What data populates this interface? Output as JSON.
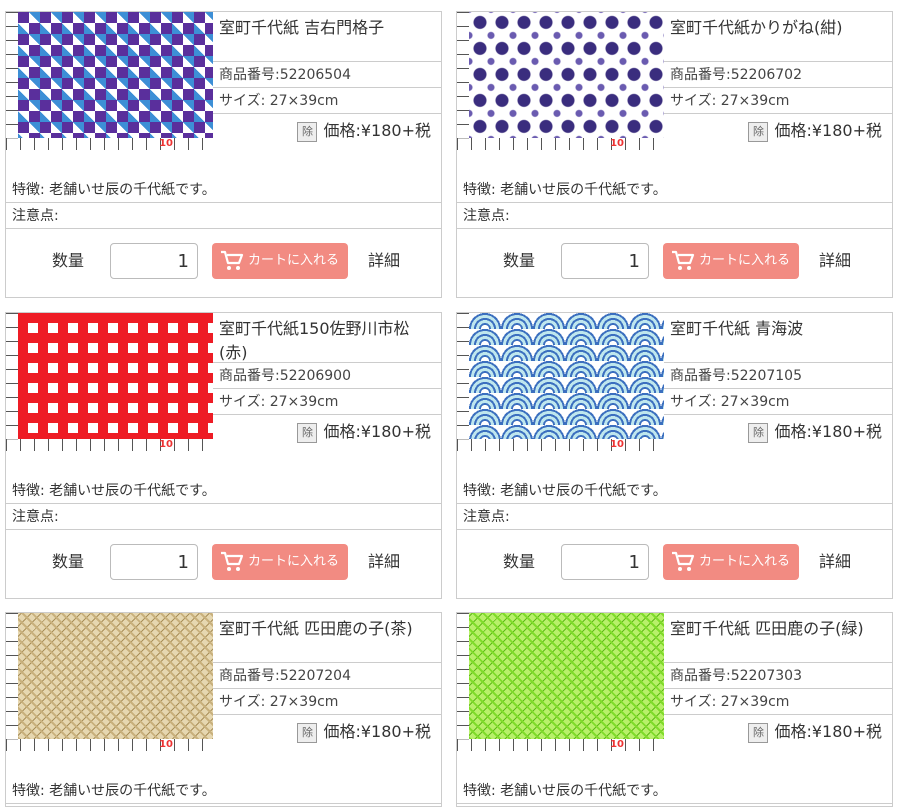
{
  "common": {
    "size": "サイズ: 27×39cm",
    "price": "価格:¥180+税",
    "price_badge": "除",
    "feature": "特徴: 老舗いせ辰の千代紙です。",
    "notice": "注意点:",
    "qty_label": "数量",
    "qty_value": "1",
    "cart_label": "カートに入れる",
    "detail_label": "詳細",
    "ruler_mark": "10"
  },
  "products": [
    {
      "title": "室町千代紙 吉右門格子",
      "code": "商品番号:52206504",
      "colors": [
        "#5a2f9c",
        "#3d8fd6",
        "#ffffff"
      ]
    },
    {
      "title": "室町千代紙かりがね(紺)",
      "code": "商品番号:52206702",
      "colors": [
        "#3a2d7e",
        "#ffffff",
        "#6a5bb0"
      ]
    },
    {
      "title": "室町千代紙150佐野川市松(赤)",
      "code": "商品番号:52206900",
      "colors": [
        "#ee1c25",
        "#ffffff",
        "#ee1c25"
      ]
    },
    {
      "title": "室町千代紙 青海波",
      "code": "商品番号:52207105",
      "colors": [
        "#3b6fbf",
        "#bfe7ee",
        "#ffffff"
      ]
    },
    {
      "title": "室町千代紙 匹田鹿の子(茶)",
      "code": "商品番号:52207204",
      "colors": [
        "#c8b07c",
        "#e6d7b0",
        "#a88e58"
      ]
    },
    {
      "title": "室町千代紙 匹田鹿の子(緑)",
      "code": "商品番号:52207303",
      "colors": [
        "#7fdc2a",
        "#b8f06a",
        "#5fb818"
      ]
    }
  ]
}
